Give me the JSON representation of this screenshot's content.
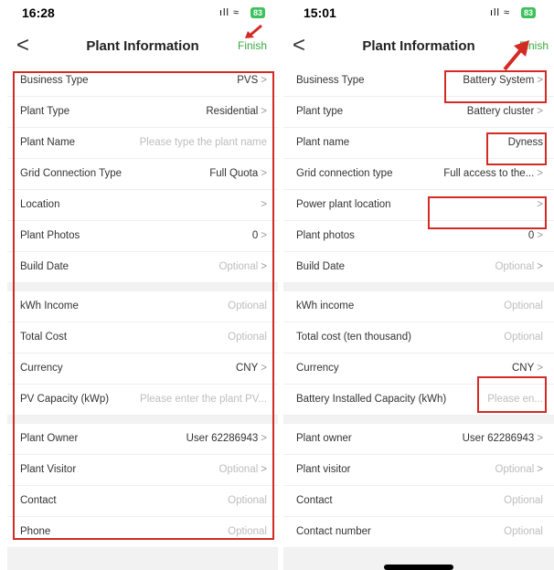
{
  "left": {
    "status": {
      "time": "16:28",
      "signal": "ıll ≈",
      "battery": "83"
    },
    "header": {
      "title": "Plant Information",
      "finish": "Finish",
      "back": "<"
    },
    "rows": [
      {
        "label": "Business Type",
        "value": "PVS",
        "chevron": ">",
        "placeholder": false
      },
      {
        "label": "Plant Type",
        "value": "Residential",
        "chevron": ">",
        "placeholder": false
      },
      {
        "label": "Plant Name",
        "value": "Please type the plant name",
        "chevron": "",
        "placeholder": true
      },
      {
        "label": "Grid Connection Type",
        "value": "Full Quota",
        "chevron": ">",
        "placeholder": false
      },
      {
        "label": "Location",
        "value": "",
        "chevron": ">",
        "placeholder": false
      },
      {
        "label": "Plant Photos",
        "value": "0",
        "chevron": ">",
        "placeholder": false
      },
      {
        "label": "Build Date",
        "value": "Optional",
        "chevron": ">",
        "placeholder": true
      },
      {
        "label": "kWh Income",
        "value": "Optional",
        "chevron": "",
        "placeholder": true
      },
      {
        "label": "Total Cost",
        "value": "Optional",
        "chevron": "",
        "placeholder": true
      },
      {
        "label": "Currency",
        "value": "CNY",
        "chevron": ">",
        "placeholder": false
      },
      {
        "label": "PV Capacity (kWp)",
        "value": "Please enter the plant PV...",
        "chevron": "",
        "placeholder": true
      },
      {
        "label": "Plant Owner",
        "value": "User 62286943",
        "chevron": ">",
        "placeholder": false
      },
      {
        "label": "Plant Visitor",
        "value": "Optional",
        "chevron": ">",
        "placeholder": true
      },
      {
        "label": "Contact",
        "value": "Optional",
        "chevron": "",
        "placeholder": true
      },
      {
        "label": "Phone",
        "value": "Optional",
        "chevron": "",
        "placeholder": true
      }
    ]
  },
  "right": {
    "status": {
      "time": "15:01",
      "signal": "ıll ≈",
      "battery": "83"
    },
    "header": {
      "title": "Plant Information",
      "finish": "Finish",
      "back": "<"
    },
    "rows": [
      {
        "label": "Business Type",
        "value": "Battery System",
        "chevron": ">",
        "placeholder": false
      },
      {
        "label": "Plant type",
        "value": "Battery cluster",
        "chevron": ">",
        "placeholder": false
      },
      {
        "label": "Plant name",
        "value": "Dyness",
        "chevron": "",
        "placeholder": false
      },
      {
        "label": "Grid connection type",
        "value": "Full access to the...",
        "chevron": ">",
        "placeholder": false
      },
      {
        "label": "Power plant location",
        "value": "",
        "chevron": ">",
        "placeholder": false
      },
      {
        "label": "Plant photos",
        "value": "0",
        "chevron": ">",
        "placeholder": false
      },
      {
        "label": "Build Date",
        "value": "Optional",
        "chevron": ">",
        "placeholder": true
      },
      {
        "label": "kWh income",
        "value": "Optional",
        "chevron": "",
        "placeholder": true
      },
      {
        "label": "Total cost (ten thousand)",
        "value": "Optional",
        "chevron": "",
        "placeholder": true
      },
      {
        "label": "Currency",
        "value": "CNY",
        "chevron": ">",
        "placeholder": false
      },
      {
        "label": "Battery Installed Capacity (kWh)",
        "value": "Please en...",
        "chevron": "",
        "placeholder": true
      },
      {
        "label": "Plant owner",
        "value": "User 62286943",
        "chevron": ">",
        "placeholder": false
      },
      {
        "label": "Plant visitor",
        "value": "Optional",
        "chevron": ">",
        "placeholder": true
      },
      {
        "label": "Contact",
        "value": "Optional",
        "chevron": "",
        "placeholder": true
      },
      {
        "label": "Contact number",
        "value": "Optional",
        "chevron": "",
        "placeholder": true
      }
    ]
  },
  "colors": {
    "accent_green": "#3aa83f",
    "annotation_red": "#d42a24",
    "placeholder_grey": "#bdbdbd"
  }
}
